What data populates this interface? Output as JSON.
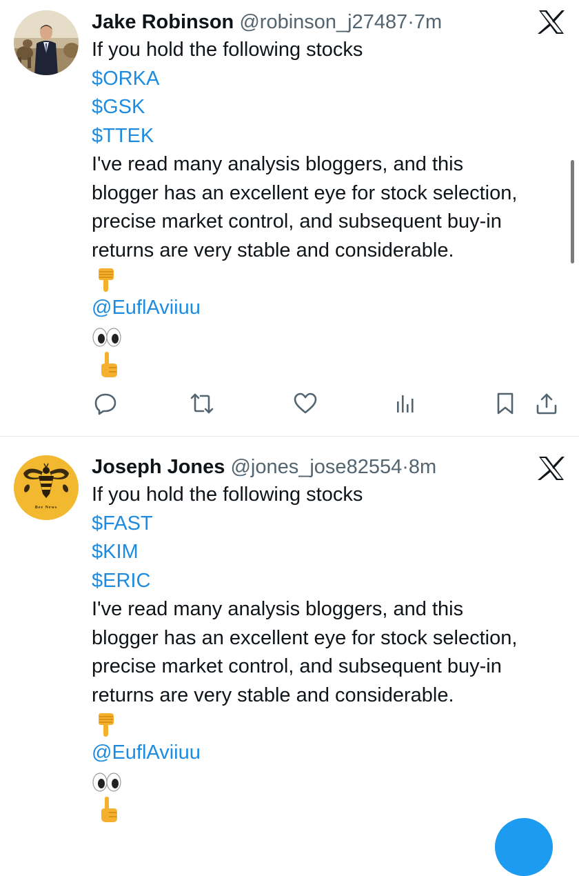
{
  "posts": [
    {
      "display_name": "Jake Robinson",
      "handle": "@robinson_j27487",
      "separator": "·",
      "time": "7m",
      "intro": "If you hold the following stocks",
      "cashtags": [
        "$ORKA",
        "$GSK",
        "$TTEK"
      ],
      "body_lines": [
        "I've read many analysis bloggers, and this",
        "blogger has an excellent eye for stock selection,",
        "precise market control, and subsequent buy-in",
        "returns are very stable and considerable."
      ],
      "mention": "@EuflAviiuu",
      "emojis": [
        "backhand-index-pointing-down",
        "eyes",
        "index-pointing-up"
      ],
      "avatar": "person-in-suit-photo"
    },
    {
      "display_name": "Joseph Jones",
      "handle": "@jones_jose82554",
      "separator": "·",
      "time": "8m",
      "intro": "If you hold the following stocks",
      "cashtags": [
        "$FAST",
        "$KIM",
        "$ERIC"
      ],
      "body_lines": [
        "I've read many analysis bloggers, and this",
        "blogger has an excellent eye for stock selection,",
        "precise market control, and subsequent buy-in",
        "returns are very stable and considerable."
      ],
      "mention": "@EuflAviiuu",
      "emojis": [
        "backhand-index-pointing-down",
        "eyes",
        "index-pointing-up"
      ],
      "avatar": "bee-logo",
      "avatar_caption": "Bee News"
    }
  ],
  "actions": [
    "reply-icon",
    "repost-icon",
    "like-icon",
    "views-icon",
    "bookmark-icon",
    "share-icon"
  ],
  "colors": {
    "link": "#1d8ce0",
    "text": "#0f1419",
    "muted": "#536471",
    "icon": "#536471",
    "avatar2_bg": "#f2b830",
    "fab": "#1d9bf0"
  }
}
